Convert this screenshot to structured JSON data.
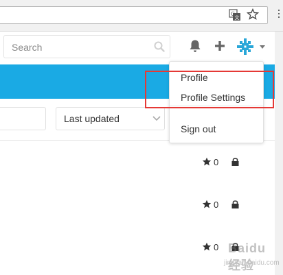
{
  "browser": {
    "address_value": "",
    "translate_icon": "translate-icon",
    "bookmark_icon": "star-icon"
  },
  "header": {
    "search_placeholder": "Search",
    "icons": [
      "bell-icon",
      "plus-icon",
      "avatar",
      "caret-down-icon"
    ]
  },
  "filters": {
    "sort_value": "Last updated"
  },
  "rows": [
    {
      "stars": "0",
      "visibility": "lock-icon"
    },
    {
      "stars": "0",
      "visibility": "lock-icon"
    },
    {
      "stars": "0",
      "visibility": "lock-icon"
    }
  ],
  "user_menu": {
    "items": [
      "Profile",
      "Profile Settings",
      "Sign out"
    ]
  },
  "watermark": {
    "main": "Baidu 经验",
    "sub": "jingyan.baidu.com"
  },
  "colors": {
    "banner": "#1aaae4",
    "highlight": "#e53935",
    "avatar": "#2aa7d8"
  }
}
